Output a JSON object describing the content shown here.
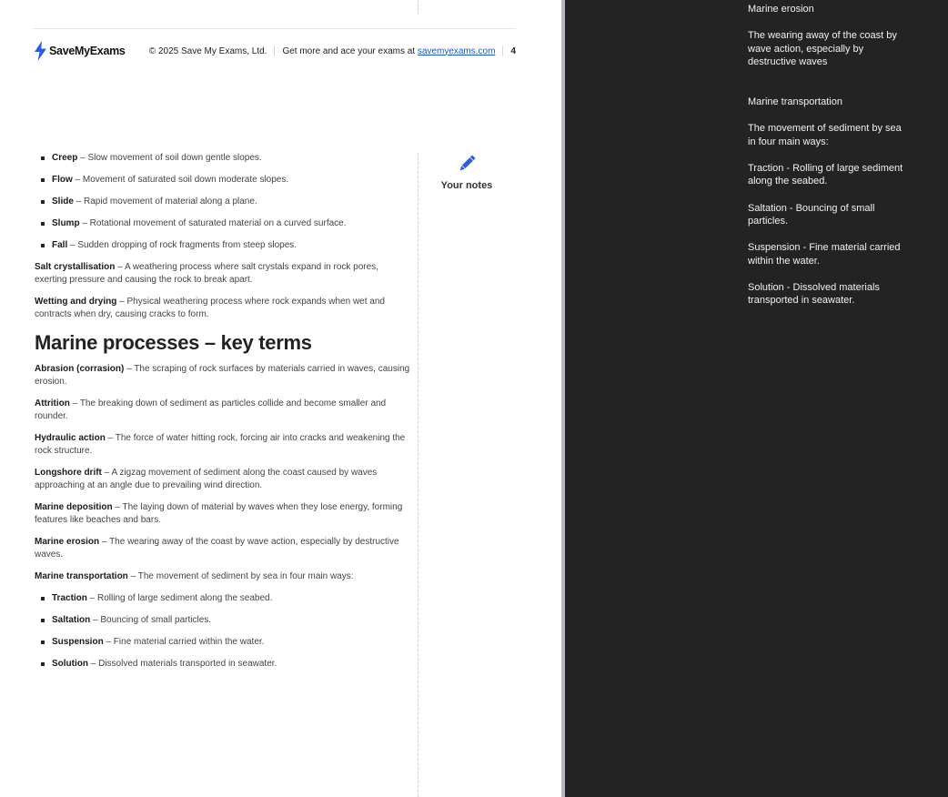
{
  "footer": {
    "logo_text": "SaveMyExams",
    "copyright": "© 2025 Save My Exams, Ltd.",
    "promo_text": "Get more and ace your exams at",
    "link_text": "savemyexams.com",
    "page_number": "4"
  },
  "notes": {
    "label": "Your notes"
  },
  "mass_movement_list": [
    {
      "term": "Creep",
      "definition": " – Slow movement of soil down gentle slopes."
    },
    {
      "term": "Flow",
      "definition": " – Movement of saturated soil down moderate slopes."
    },
    {
      "term": "Slide",
      "definition": " – Rapid movement of material along a plane."
    },
    {
      "term": "Slump",
      "definition": " – Rotational movement of saturated material on a curved surface."
    },
    {
      "term": "Fall",
      "definition": " – Sudden dropping of rock fragments from steep slopes."
    }
  ],
  "weathering_terms": [
    {
      "term": "Salt crystallisation",
      "definition": " – A weathering process where salt crystals expand in rock pores, exerting pressure and causing the rock to break apart."
    },
    {
      "term": "Wetting and drying",
      "definition": " – Physical weathering process where rock expands when wet and contracts when dry, causing cracks to form."
    }
  ],
  "marine_heading": "Marine processes – key terms",
  "marine_terms": [
    {
      "term": "Abrasion (corrasion)",
      "definition": " – The scraping of rock surfaces by materials carried in waves, causing erosion."
    },
    {
      "term": "Attrition",
      "definition": " – The breaking down of sediment as particles collide and become smaller and rounder."
    },
    {
      "term": "Hydraulic action",
      "definition": " – The force of water hitting rock, forcing air into cracks and weakening the rock structure."
    },
    {
      "term": "Longshore drift",
      "definition": " – A zigzag movement of sediment along the coast caused by waves approaching at an angle due to prevailing wind direction."
    },
    {
      "term": "Marine deposition",
      "definition": " – The laying down of material by waves when they lose energy, forming features like beaches and bars."
    },
    {
      "term": "Marine erosion",
      "definition": " – The wearing away of the coast by wave action, especially by destructive waves."
    },
    {
      "term": "Marine transportation",
      "definition": " – The movement of sediment by sea in four main ways:"
    }
  ],
  "transport_list": [
    {
      "term": "Traction",
      "definition": " – Rolling of large sediment along the seabed."
    },
    {
      "term": "Saltation",
      "definition": " – Bouncing of small particles."
    },
    {
      "term": "Suspension",
      "definition": " – Fine material carried within the water."
    },
    {
      "term": "Solution",
      "definition": " – Dissolved materials transported in seawater."
    }
  ],
  "side_panel": {
    "lines": [
      "Marine erosion",
      "The wearing away of the coast by wave action, especially by destructive waves",
      "",
      "Marine transportation",
      "The movement of sediment by sea in four main ways:",
      "Traction - Rolling of large sediment along the seabed.",
      "Saltation - Bouncing of small particles.",
      "Suspension - Fine material carried within the water.",
      "Solution - Dissolved materials transported in seawater."
    ]
  },
  "colors": {
    "brand_bolt": "#2b5ce6",
    "link": "#1a57c8",
    "side_panel_bg": "#232323",
    "scroll_separator": "#b9b3c8"
  }
}
